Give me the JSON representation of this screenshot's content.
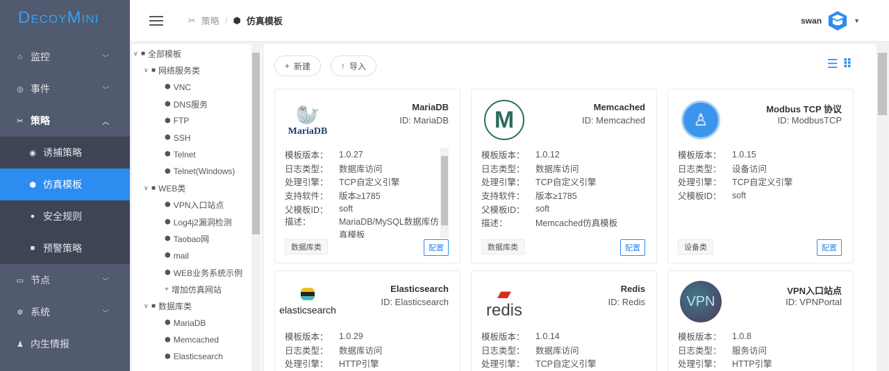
{
  "brand": "DecoyMini",
  "sidebar": {
    "items": [
      {
        "label": "监控",
        "icon": "home-icon"
      },
      {
        "label": "事件",
        "icon": "target-icon"
      },
      {
        "label": "策略",
        "icon": "tools-icon"
      },
      {
        "label": "诱捕策略",
        "icon": "eye-icon"
      },
      {
        "label": "仿真模板",
        "icon": "cube-icon"
      },
      {
        "label": "安全规则",
        "icon": "rule-icon"
      },
      {
        "label": "预警策略",
        "icon": "alarm-icon"
      },
      {
        "label": "节点",
        "icon": "monitor-icon"
      },
      {
        "label": "系统",
        "icon": "gear-icon"
      },
      {
        "label": "内生情报",
        "icon": "user-icon"
      }
    ]
  },
  "header": {
    "breadcrumb": [
      "策略",
      "仿真模板"
    ],
    "user": "swan"
  },
  "tree": {
    "items": [
      {
        "label": "全部模板",
        "level": 0,
        "type": "folder"
      },
      {
        "label": "网络服务类",
        "level": 1,
        "type": "folder"
      },
      {
        "label": "VNC",
        "level": 2,
        "type": "leaf"
      },
      {
        "label": "DNS服务",
        "level": 2,
        "type": "leaf"
      },
      {
        "label": "FTP",
        "level": 2,
        "type": "leaf"
      },
      {
        "label": "SSH",
        "level": 2,
        "type": "leaf"
      },
      {
        "label": "Telnet",
        "level": 2,
        "type": "leaf"
      },
      {
        "label": "Telnet(Windows)",
        "level": 2,
        "type": "leaf"
      },
      {
        "label": "WEB类",
        "level": 1,
        "type": "folder"
      },
      {
        "label": "VPN入口站点",
        "level": 2,
        "type": "leaf"
      },
      {
        "label": "Log4j2漏洞检测",
        "level": 2,
        "type": "leaf"
      },
      {
        "label": "Taobao网",
        "level": 2,
        "type": "leaf"
      },
      {
        "label": "mail",
        "level": 2,
        "type": "leaf"
      },
      {
        "label": "WEB业务系统示例",
        "level": 2,
        "type": "leaf"
      },
      {
        "label": "增加仿真网站",
        "level": 2,
        "type": "add"
      },
      {
        "label": "数据库类",
        "level": 1,
        "type": "folder"
      },
      {
        "label": "MariaDB",
        "level": 2,
        "type": "leaf"
      },
      {
        "label": "Memcached",
        "level": 2,
        "type": "leaf"
      },
      {
        "label": "Elasticsearch",
        "level": 2,
        "type": "leaf"
      }
    ]
  },
  "toolbar": {
    "new": "新建",
    "import": "导入"
  },
  "cards": [
    {
      "title": "MariaDB",
      "id": "ID: MariaDB",
      "logo": "MariaDB",
      "props": [
        [
          "模板版本：",
          "1.0.27"
        ],
        [
          "日志类型：",
          "数据库访问"
        ],
        [
          "处理引擎：",
          "TCP自定义引擎"
        ],
        [
          "支持软件：",
          "版本≥1785"
        ],
        [
          "父模板ID：",
          "soft"
        ],
        [
          "描述：",
          "MariaDB/MySQL数据库仿真模板"
        ]
      ],
      "tag": "数据库类",
      "config": "配置"
    },
    {
      "title": "Memcached",
      "id": "ID: Memcached",
      "logo": "M",
      "props": [
        [
          "模板版本：",
          "1.0.12"
        ],
        [
          "日志类型：",
          "数据库访问"
        ],
        [
          "处理引擎：",
          "TCP自定义引擎"
        ],
        [
          "支持软件：",
          "版本≥1785"
        ],
        [
          "父模板ID：",
          "soft"
        ],
        [
          "描述：",
          "Memcached仿真模板"
        ]
      ],
      "tag": "数据库类",
      "config": "配置"
    },
    {
      "title": "Modbus TCP 协议",
      "id": "ID: ModbusTCP",
      "logo": "",
      "props": [
        [
          "模板版本：",
          "1.0.15"
        ],
        [
          "日志类型：",
          "设备访问"
        ],
        [
          "处理引擎：",
          "TCP自定义引擎"
        ],
        [
          "父模板ID：",
          "soft"
        ]
      ],
      "tag": "设备类",
      "config": "配置"
    },
    {
      "title": "Elasticsearch",
      "id": "ID: Elasticsearch",
      "logo": "elasticsearch",
      "props": [
        [
          "模板版本：",
          "1.0.29"
        ],
        [
          "日志类型：",
          "数据库访问"
        ],
        [
          "处理引擎：",
          "HTTP引擎"
        ]
      ],
      "tag": "",
      "config": ""
    },
    {
      "title": "Redis",
      "id": "ID: Redis",
      "logo": "redis",
      "props": [
        [
          "模板版本：",
          "1.0.14"
        ],
        [
          "日志类型：",
          "数据库访问"
        ],
        [
          "处理引擎：",
          "TCP自定义引擎"
        ]
      ],
      "tag": "",
      "config": ""
    },
    {
      "title": "VPN入口站点",
      "id": "ID: VPNPortal",
      "logo": "VPN",
      "props": [
        [
          "模板版本：",
          "1.0.8"
        ],
        [
          "日志类型：",
          "服务访问"
        ],
        [
          "处理引擎：",
          "HTTP引擎"
        ]
      ],
      "tag": "",
      "config": ""
    }
  ]
}
